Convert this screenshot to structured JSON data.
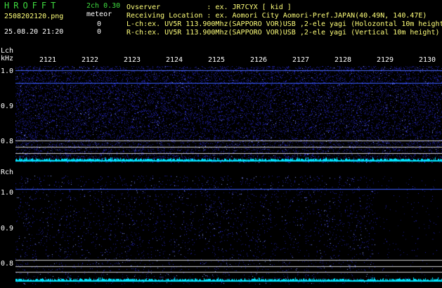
{
  "header": {
    "logo": "HROFFT",
    "channel_info": "2ch 0.30",
    "filename": "2508202120.png",
    "meteor_label": "meteor",
    "meteor_count_l": "0",
    "meteor_count_r": "0",
    "datetime": "25.08.20 21:20",
    "observer_line": "Ovserver           : ex. JR7CYX [ kid ]",
    "location_line": "Receiving Location : ex. Aomori City Aomori-Pref.JAPAN(40.49N, 140.47E)",
    "lch_line": "L-ch:ex. UV5R 113.900Mhz(SAPPORO VOR)USB ,2-ele yagi (Holozontal 10m height)",
    "rch_line": "R-ch:ex. UV5R 113.900Mhz(SAPPORO VOR)USB ,2-ele yagi (Vertical 10m height)"
  },
  "lch": {
    "title": "Lch",
    "unit": "kHz",
    "yticks": [
      "1.0",
      "0.9",
      "0.8"
    ]
  },
  "rch": {
    "title": "Rch",
    "yticks": [
      "1.0",
      "0.9",
      "0.8"
    ]
  },
  "time_ticks": [
    "2121",
    "2122",
    "2123",
    "2124",
    "2125",
    "2126",
    "2127",
    "2128",
    "2129",
    "2130"
  ],
  "colors": {
    "background": "#000000",
    "noise": "#1a1aa0",
    "signal_line": "#3a5cff",
    "baseline_band": "#00e5ff",
    "header_green": "#3fdc3f",
    "header_yellow": "#ffff7a"
  }
}
